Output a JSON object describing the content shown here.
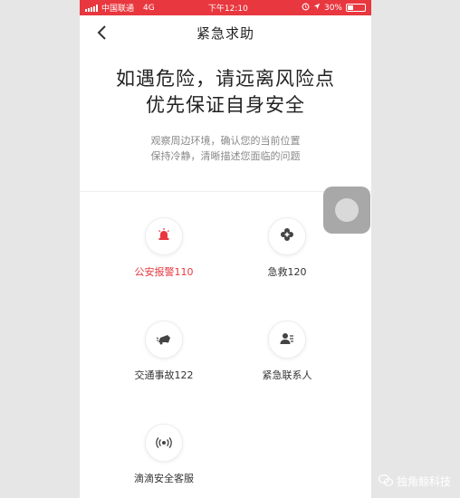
{
  "status_bar": {
    "carrier": "中国联通",
    "network": "4G",
    "time": "下午12:10",
    "battery": "30%",
    "battery_level": 0.3
  },
  "nav": {
    "back_icon": "chevron-left-icon",
    "title": "紧急求助"
  },
  "hero": {
    "line1": "如遇危险，请远离风险点",
    "line2": "优先保证自身安全",
    "sub1": "观察周边环境，确认您的当前位置",
    "sub2": "保持冷静，清晰描述您面临的问题"
  },
  "actions": [
    {
      "label": "公安报警110",
      "icon": "police-siren-icon",
      "color": "#e8373f"
    },
    {
      "label": "急救120",
      "icon": "first-aid-icon"
    },
    {
      "label": "交通事故122",
      "icon": "car-accident-icon"
    },
    {
      "label": "紧急联系人",
      "icon": "contact-icon"
    },
    {
      "label": "滴滴安全客服",
      "icon": "broadcast-icon"
    }
  ],
  "watermark": "独角鲸科技"
}
